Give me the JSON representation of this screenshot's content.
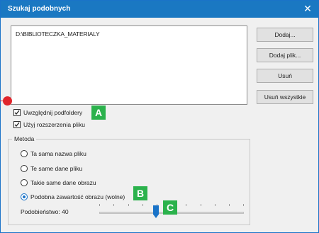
{
  "dialog": {
    "title": "Szukaj podobnych"
  },
  "folders": [
    "D:\\BIBLIOTECZKA_MATERIALY"
  ],
  "buttons": {
    "add": "Dodaj...",
    "add_file": "Dodaj plik...",
    "remove": "Usuń",
    "remove_all": "Usuń wszystkie"
  },
  "options": {
    "include_subfolders": {
      "label": "Uwzględnij podfoldery",
      "checked": true
    },
    "use_extensions": {
      "label": "Użyj rozszerzenia pliku",
      "checked": true
    }
  },
  "method": {
    "title": "Metoda",
    "choices": [
      {
        "label": "Ta sama nazwa pliku",
        "selected": false
      },
      {
        "label": "Te same dane pliku",
        "selected": false
      },
      {
        "label": "Takie same dane obrazu",
        "selected": false
      },
      {
        "label": "Podobna zawartość obrazu (wolne)",
        "selected": true
      }
    ],
    "similarity_label": "Podobieństwo: 40",
    "similarity_value": 40
  },
  "markers": {
    "a": "A",
    "b": "B",
    "c": "C"
  },
  "colors": {
    "title_bar": "#1a78c2",
    "marker": "#2bb24c",
    "callout_dot": "#e0252b",
    "accent": "#1a73c8"
  }
}
